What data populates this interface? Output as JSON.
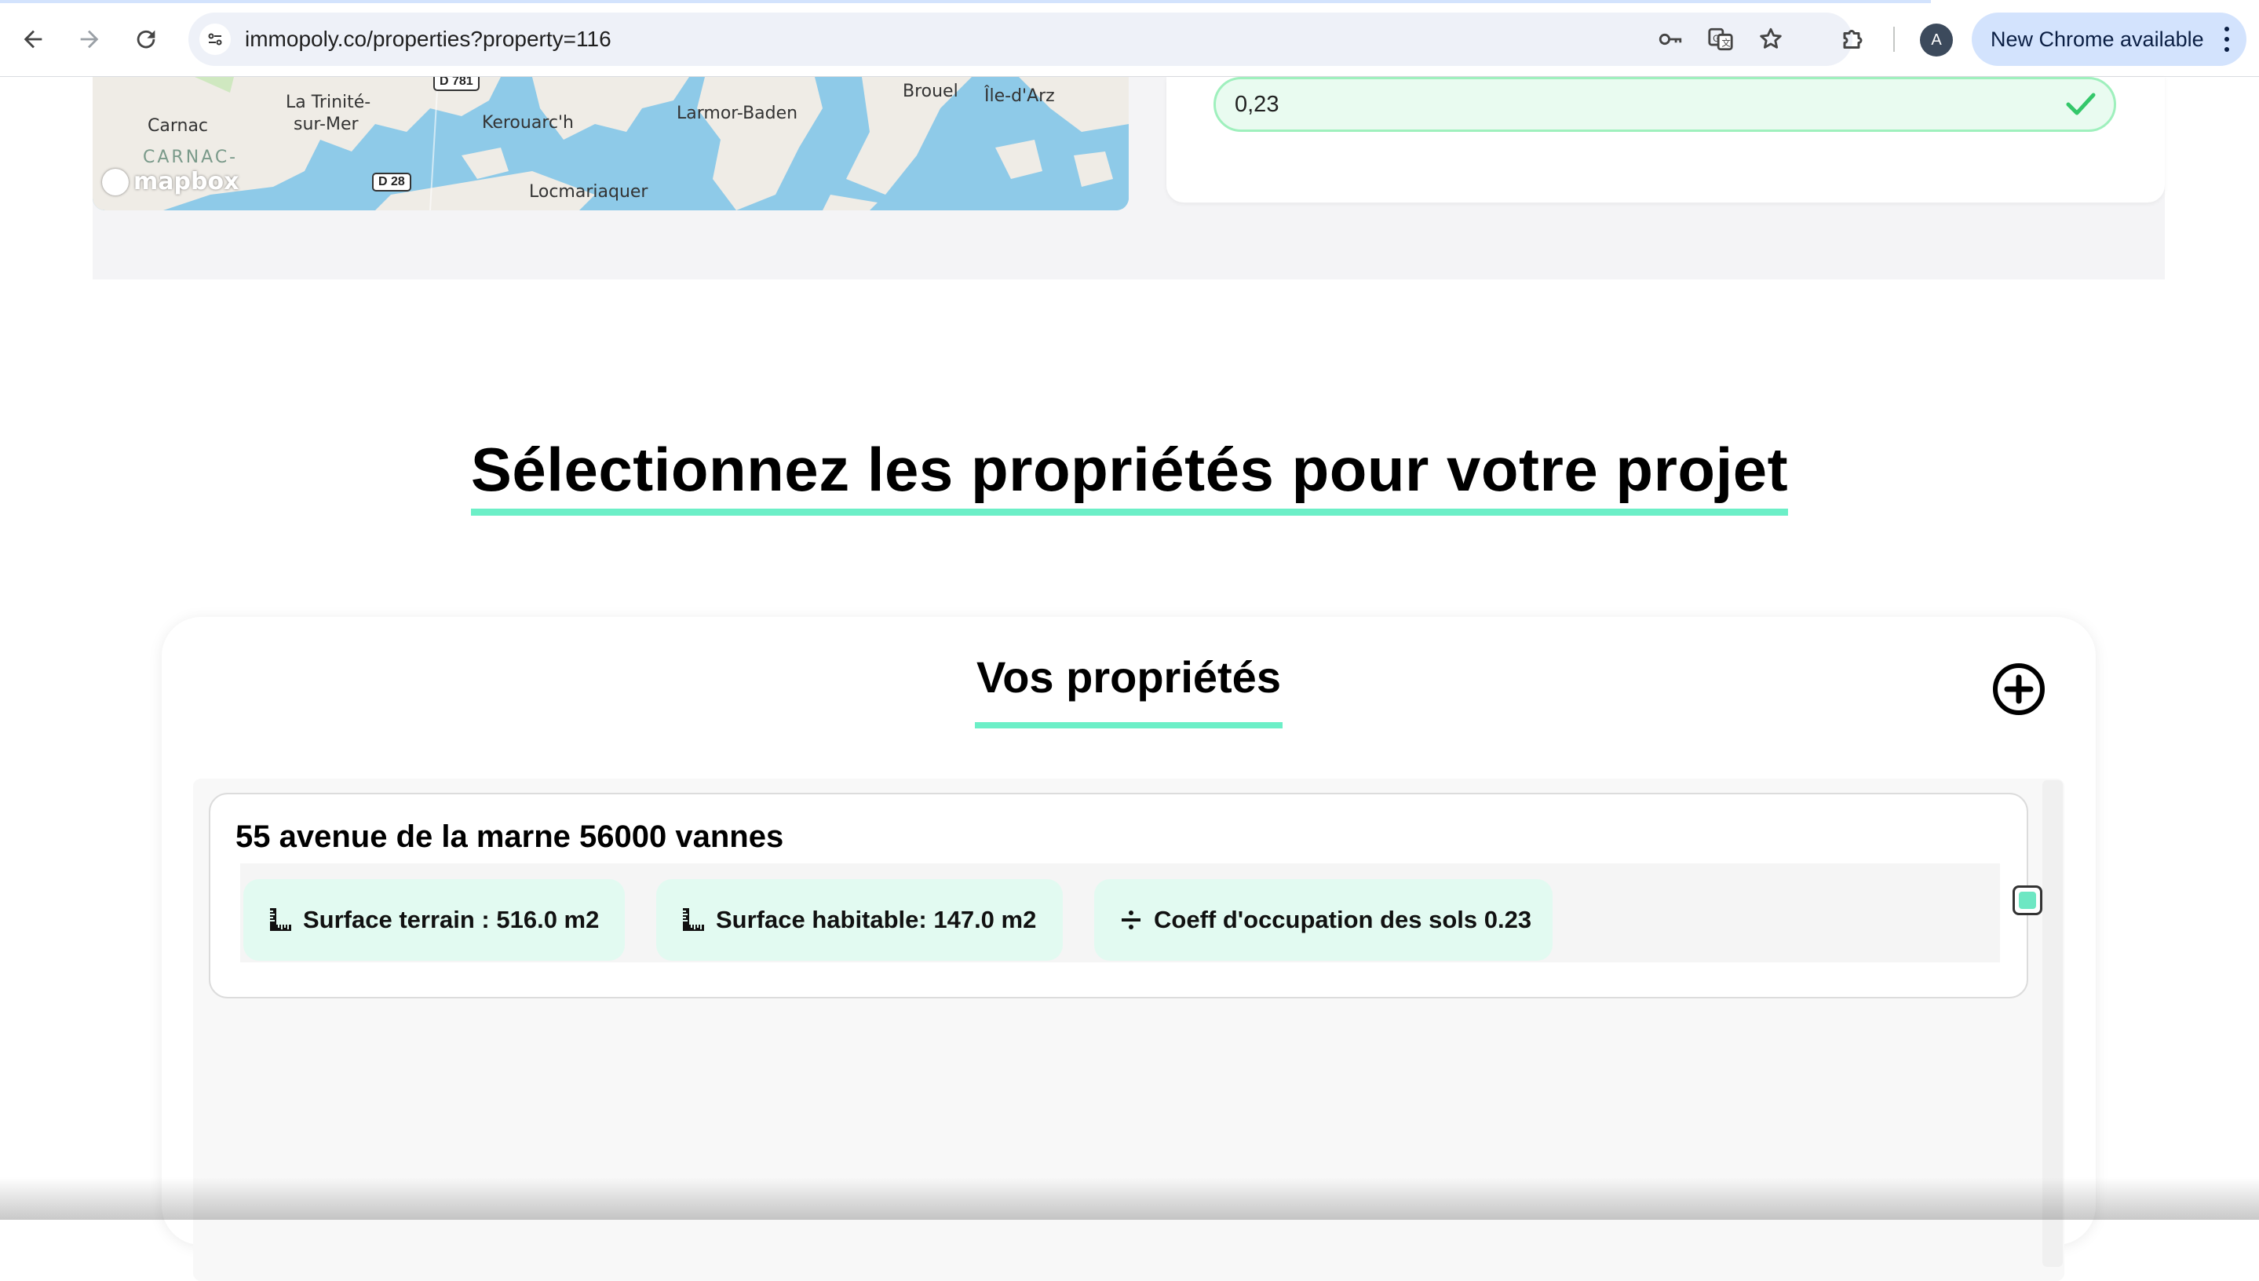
{
  "browser": {
    "url": "immopoly.co/properties?property=116",
    "profile_initial": "A",
    "update_label": "New Chrome available"
  },
  "map": {
    "labels": [
      "Carnac",
      "La Trinité-",
      "sur-Mer",
      "CARNAC-",
      "Kerouarc'h",
      "Larmor-Baden",
      "Brouel",
      "Île-d'Arz",
      "Locmariaquer"
    ],
    "roads": [
      "D 781",
      "D 28"
    ],
    "attribution": "mapbox"
  },
  "result": {
    "coef_value": "0,23"
  },
  "section": {
    "heading": "Sélectionnez les propriétés pour votre projet"
  },
  "panel": {
    "title": "Vos propriétés",
    "properties": [
      {
        "address": "55 avenue de la marne 56000 vannes",
        "features": [
          {
            "icon": "ruler-icon",
            "label": "Surface terrain : 516.0 m2"
          },
          {
            "icon": "ruler-icon",
            "label": "Surface habitable: 147.0 m2"
          },
          {
            "icon": "divide-icon",
            "label": "Coeff d'occupation des sols 0.23"
          }
        ],
        "selected": true
      }
    ]
  },
  "colors": {
    "accent": "#6cefc7",
    "chip_bg": "#e2faf1",
    "success_field_bg": "#e9fbf0",
    "success_check": "#34c76a"
  }
}
